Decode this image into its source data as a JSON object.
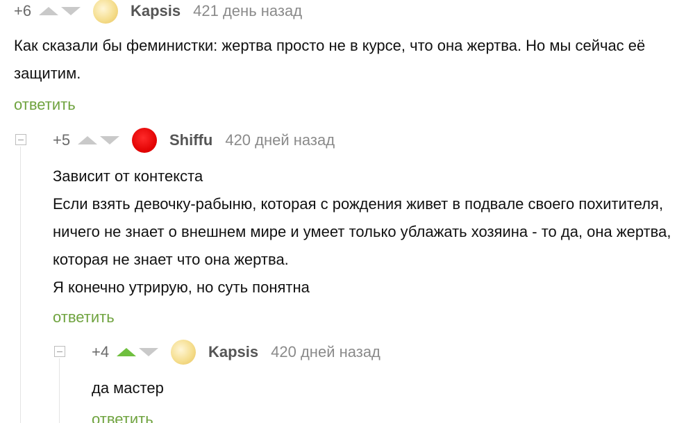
{
  "comments": [
    {
      "rating": "+6",
      "user": "Kapsis",
      "time": "421 день назад",
      "text": [
        "Как сказали бы феминистки: жертва просто не в курсе, что она жертва. Но мы сейчас её защитим."
      ],
      "reply_label": "ответить"
    },
    {
      "rating": "+5",
      "user": "Shiffu",
      "time": "420 дней назад",
      "text": [
        "Зависит от контекста",
        "Если взять девочку-рабыню, которая с рождения живет в подвале своего похитителя, ничего не знает о внешнем мире и умеет только ублажать хозяина - то да, она жертва, которая не знает что она жертва.",
        "Я конечно утрирую, но суть понятна"
      ],
      "reply_label": "ответить"
    },
    {
      "rating": "+4",
      "user": "Kapsis",
      "time": "420 дней назад",
      "text": [
        "да мастер"
      ],
      "reply_label": "ответить"
    }
  ],
  "colors": {
    "reply_green": "#6fa33f",
    "upvoted_green": "#6fbf3e",
    "vote_gray": "#c9c9c9"
  },
  "icons": [
    "upvote-icon",
    "downvote-icon",
    "collapse-thread-icon",
    "avatar"
  ]
}
